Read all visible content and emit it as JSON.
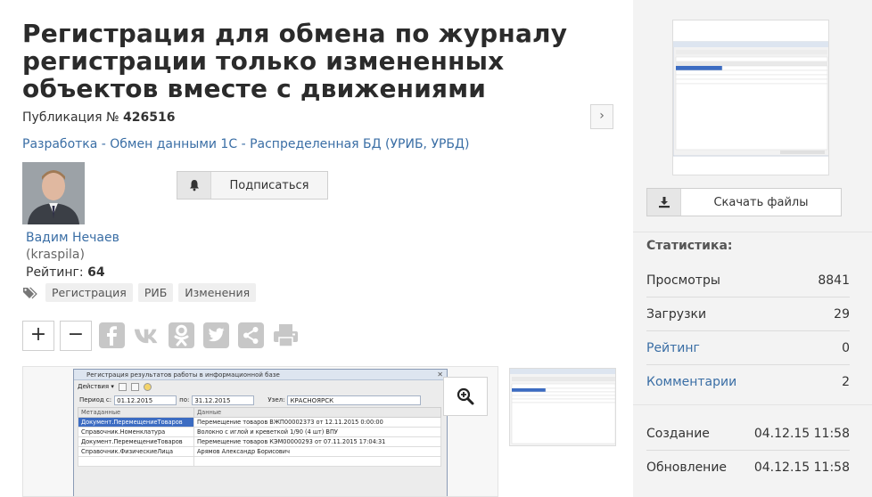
{
  "article": {
    "title": "Регистрация для обмена по журналу регистрации только измененных объектов вместе с движениями",
    "pub_label": "Публикация №",
    "pub_number": "426516",
    "next_arrow": "›",
    "breadcrumb": "Разработка - Обмен данными 1С - Распределенная БД (УРИБ, УРБД)",
    "subscribe_label": "Подписаться"
  },
  "author": {
    "name": "Вадим Нечаев",
    "login": "(kraspila)",
    "rating_label": "Рейтинг:",
    "rating_value": "64"
  },
  "tags": [
    "Регистрация",
    "РИБ",
    "Изменения"
  ],
  "controls": {
    "plus": "+",
    "minus": "−"
  },
  "share_icons": [
    "facebook-icon",
    "vk-icon",
    "odnoklassniki-icon",
    "twitter-icon",
    "share-icon",
    "print-icon"
  ],
  "screenshot": {
    "window_title": "Регистрация результатов работы в информационной базе",
    "menu_actions": "Действия ▾",
    "period_label": "Период с:",
    "period_from": "01.12.2015",
    "period_to_label": "по:",
    "period_to": "31.12.2015",
    "node_label": "Узел:",
    "node_value": "КРАСНОЯРСК",
    "col_meta": "Метаданные",
    "col_data": "Данные",
    "rows": [
      {
        "meta": "Документ.ПеремещениеТоваров",
        "data": "Перемещение товаров ВЖП00002373 от 12.11.2015 0:00:00"
      },
      {
        "meta": "Справочник.Номенклатура",
        "data": "Волокно с иглой и креветкой 1/90 (4 шт) ВПУ"
      },
      {
        "meta": "Документ.ПеремещениеТоваров",
        "data": "Перемещение товаров КЭМ00000293 от 07.11.2015 17:04:31"
      },
      {
        "meta": "Справочник.ФизическиеЛица",
        "data": "Арямов Александр Борисович"
      }
    ]
  },
  "sidebar": {
    "download_label": "Скачать файлы",
    "stats_title": "Статистика:",
    "stats": [
      {
        "key": "Просмотры",
        "value": "8841",
        "link": false
      },
      {
        "key": "Загрузки",
        "value": "29",
        "link": false
      },
      {
        "key": "Рейтинг",
        "value": "0",
        "link": true
      },
      {
        "key": "Комментарии",
        "value": "2",
        "link": true
      }
    ],
    "created_label": "Создание",
    "created_value": "04.12.15 11:58",
    "updated_label": "Обновление",
    "updated_value": "04.12.15 11:58"
  },
  "colors": {
    "link": "#3a6ea5",
    "sidebar_bg": "#f3f3f3",
    "icon_gray": "#c7c7c7"
  }
}
